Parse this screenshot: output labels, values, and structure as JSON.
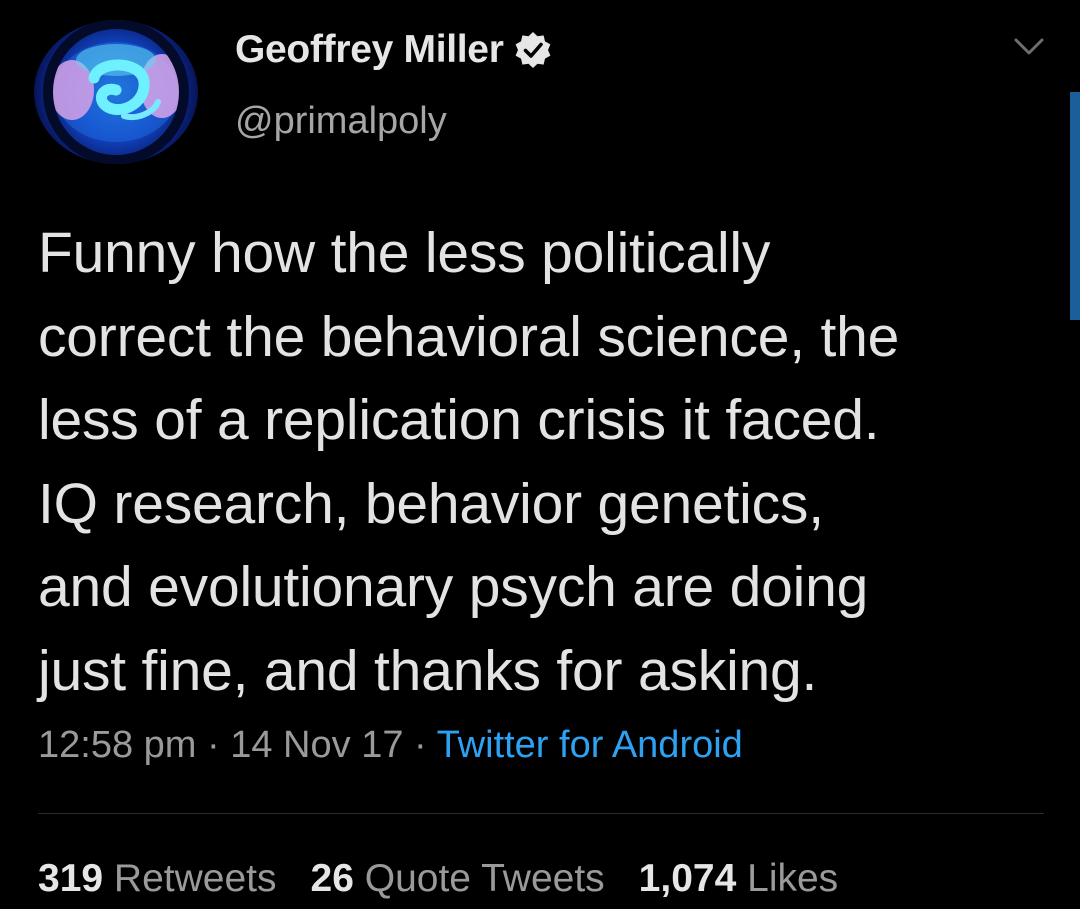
{
  "author": {
    "display_name": "Geoffrey Miller",
    "handle": "@primalpoly",
    "verified": true
  },
  "icons": {
    "verified": "verified-badge-icon",
    "more": "chevron-down-icon"
  },
  "tweet": {
    "text": "Funny how the less politically\ncorrect the behavioral science, the\nless of a replication crisis it faced.\nIQ research, behavior genetics,\nand evolutionary psych are doing\njust fine, and thanks for asking."
  },
  "meta": {
    "time": "12:58 pm",
    "sep1": " · ",
    "date": "14 Nov 17",
    "sep2": " · ",
    "source": "Twitter for Android"
  },
  "stats": {
    "retweets_count": "319",
    "retweets_label": "Retweets",
    "quotes_count": "26",
    "quotes_label": "Quote Tweets",
    "likes_count": "1,074",
    "likes_label": "Likes"
  },
  "colors": {
    "background": "#000000",
    "text": "#e3e3e3",
    "secondary": "#9a9a9a",
    "link": "#2ea2f2"
  }
}
